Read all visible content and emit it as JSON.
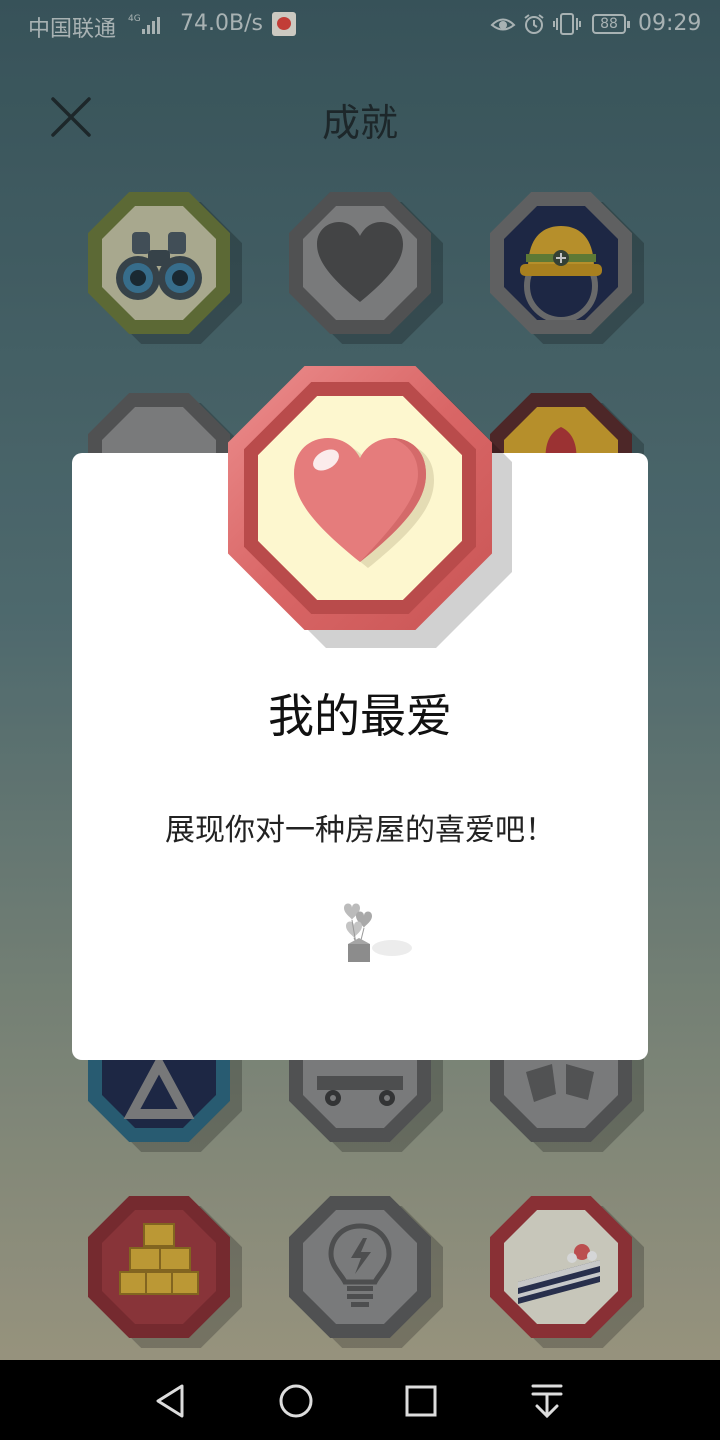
{
  "status_bar": {
    "carrier": "中国联通",
    "network": "4G",
    "speed": "74.0B/s",
    "battery": "88",
    "time": "09:29",
    "icons": [
      "signal-icon",
      "app-notification-icon",
      "eye-icon",
      "alarm-icon",
      "vibrate-icon",
      "battery-icon"
    ]
  },
  "header": {
    "title": "成就",
    "close_icon": "close-icon"
  },
  "badges": [
    {
      "name": "binoculars",
      "frame": "#6c7a3a",
      "face": "#c9c7a7"
    },
    {
      "name": "heart-locked",
      "frame": "#5d5d5d",
      "face": "#8f8f8f"
    },
    {
      "name": "hard-hat",
      "frame": "#6f6f6f",
      "face": "#1f2a4c"
    },
    {
      "name": "bottom-left",
      "frame": "#2d6a83",
      "face": "#1f2a4c"
    },
    {
      "name": "truck",
      "frame": "#5d5d5d",
      "face": "#8f8f8f"
    },
    {
      "name": "bottom-right",
      "frame": "#5d5d5d",
      "face": "#8f8f8f"
    },
    {
      "name": "gold-bars",
      "frame": "#8a2e33",
      "face": "#a23a3f"
    },
    {
      "name": "lightbulb",
      "frame": "#5d5d5d",
      "face": "#8f8f8f"
    },
    {
      "name": "cake",
      "frame": "#a3353a",
      "face": "#eeecdc"
    }
  ],
  "dialog": {
    "badge_icon": "heart-icon",
    "title": "我的最爱",
    "description": "展现你对一种房屋的喜爱吧！",
    "illustration": "balloons-gift-icon",
    "colors": {
      "ring": "#d96666",
      "cream": "#fdf7cf",
      "heart": "#e57c7c"
    }
  },
  "nav_bar": {
    "buttons": [
      "back-icon",
      "home-icon",
      "recents-icon",
      "notifications-pull-icon"
    ]
  }
}
